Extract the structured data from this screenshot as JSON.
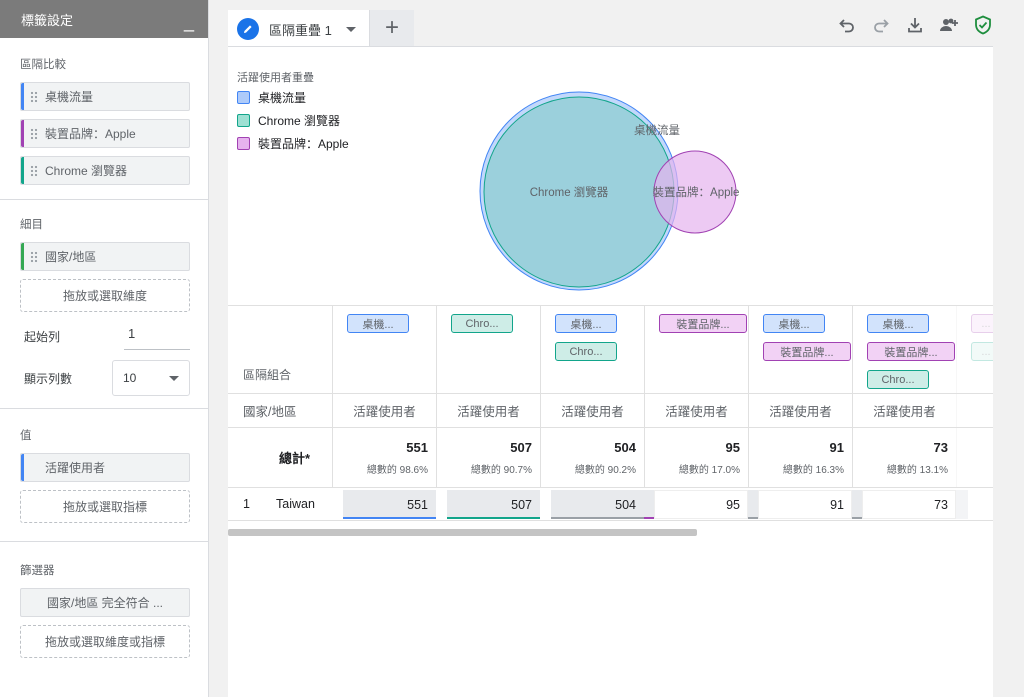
{
  "panel": {
    "title": "標籤設定",
    "collapse": "_",
    "segments": {
      "title": "區隔比較",
      "items": [
        {
          "label": "桌機流量",
          "color": "#4285f4"
        },
        {
          "label": "裝置品牌：Apple",
          "color": "#a142b3"
        },
        {
          "label": "Chrome 瀏覽器",
          "color": "#12a58b"
        }
      ]
    },
    "breakdowns": {
      "title": "細目",
      "item": "國家/地區",
      "item_color": "#34a853",
      "drop": "拖放或選取維度",
      "start_row_label": "起始列",
      "start_row_value": "1",
      "rows_label": "顯示列數",
      "rows_value": "10"
    },
    "values": {
      "title": "值",
      "item": "活躍使用者",
      "item_color": "#4285f4",
      "drop": "拖放或選取指標"
    },
    "filters": {
      "title": "篩選器",
      "item": "國家/地區 完全符合 ...",
      "drop": "拖放或選取維度或指標"
    }
  },
  "tab": {
    "label": "區隔重疊 1",
    "add": "+"
  },
  "toolbar": [
    "undo-icon",
    "redo-icon",
    "download-icon",
    "share-icon",
    "verified-shield-icon"
  ],
  "chart": {
    "title": "活躍使用者重疊",
    "legend": [
      {
        "label": "桌機流量",
        "fill": "#aecbfa",
        "stroke": "#4285f4"
      },
      {
        "label": "Chrome 瀏覽器",
        "fill": "#9ee0d3",
        "stroke": "#12a58b"
      },
      {
        "label": "裝置品牌：Apple",
        "fill": "#e6b3ee",
        "stroke": "#a142b3"
      }
    ],
    "labels": {
      "desktop": "桌機流量",
      "chrome": "Chrome 瀏覽器",
      "apple": "裝置品牌：Apple"
    }
  },
  "table": {
    "combo_label": "區隔組合",
    "dim_label": "國家/地區",
    "columns": [
      {
        "tags": [
          {
            "label": "桌機...",
            "type": "blue"
          }
        ]
      },
      {
        "tags": [
          {
            "label": "Chro...",
            "type": "teal"
          }
        ]
      },
      {
        "tags": [
          {
            "label": "桌機...",
            "type": "blue"
          },
          {
            "label": "Chro...",
            "type": "teal"
          }
        ]
      },
      {
        "tags": [
          {
            "label": "裝置品牌...",
            "type": "pink"
          }
        ]
      },
      {
        "tags": [
          {
            "label": "桌機...",
            "type": "blue"
          },
          {
            "label": "裝置品牌...",
            "type": "pink"
          }
        ]
      },
      {
        "tags": [
          {
            "label": "桌機...",
            "type": "blue"
          },
          {
            "label": "裝置品牌...",
            "type": "pink"
          },
          {
            "label": "Chro...",
            "type": "teal"
          }
        ]
      },
      {
        "tags": [
          {
            "label": "...",
            "type": "pink"
          },
          {
            "label": "...",
            "type": "teal"
          }
        ]
      }
    ],
    "metric": "活躍使用者",
    "total_label": "總計*",
    "totals": [
      {
        "value": "551",
        "pct": "總數的 98.6%"
      },
      {
        "value": "507",
        "pct": "總數的 90.7%"
      },
      {
        "value": "504",
        "pct": "總數的 90.2%"
      },
      {
        "value": "95",
        "pct": "總數的 17.0%"
      },
      {
        "value": "91",
        "pct": "總數的 16.3%"
      },
      {
        "value": "73",
        "pct": "總數的 13.1%"
      }
    ],
    "rows": [
      {
        "index": "1",
        "name": "Taiwan",
        "values": [
          "551",
          "507",
          "504",
          "95",
          "91",
          "73"
        ],
        "fractions": [
          1.0,
          0.92,
          0.915,
          0.172,
          0.165,
          0.132
        ],
        "colors": [
          "#4285f4",
          "#12a58b",
          "#9aa0a6",
          "#a142b3",
          "#9aa0a6",
          "#9aa0a6"
        ]
      }
    ]
  }
}
